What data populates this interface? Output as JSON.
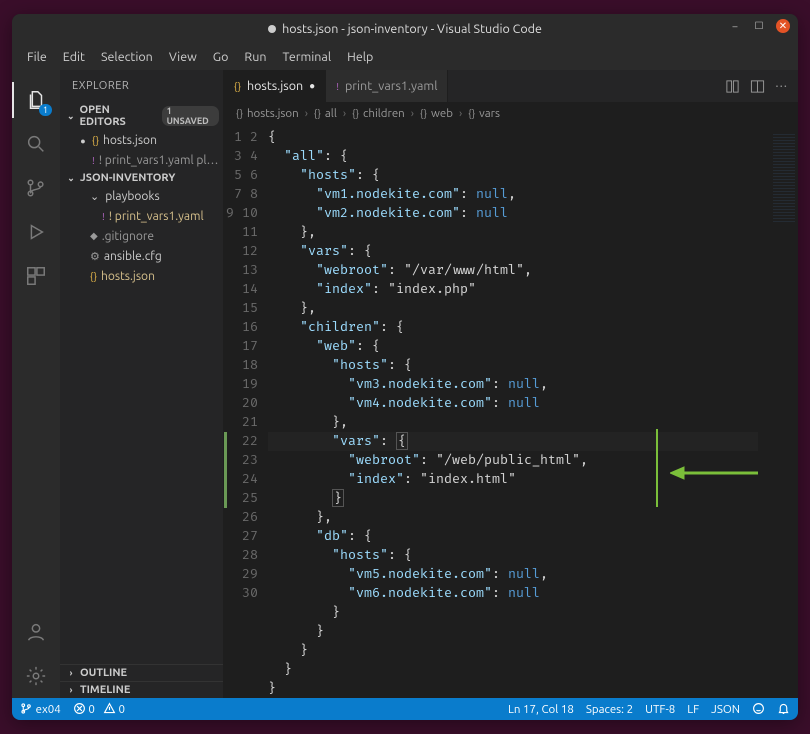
{
  "title": "hosts.json - json-inventory - Visual Studio Code",
  "menu": [
    "File",
    "Edit",
    "Selection",
    "View",
    "Go",
    "Run",
    "Terminal",
    "Help"
  ],
  "activity_badge": "1",
  "sidebar": {
    "title": "EXPLORER",
    "open_editors": {
      "label": "OPEN EDITORS",
      "badge": "1 UNSAVED",
      "items": [
        {
          "label": "hosts.json",
          "modified": true,
          "icon": "json"
        },
        {
          "label": "! print_vars1.yaml  pl…",
          "modified": false,
          "icon": "yaml"
        }
      ]
    },
    "workspace": {
      "label": "JSON-INVENTORY",
      "items": [
        {
          "label": "playbooks",
          "icon": "folder",
          "level": 2,
          "chev": true
        },
        {
          "label": "! print_vars1.yaml",
          "icon": "yaml",
          "level": 3,
          "cls": "yellowish"
        },
        {
          "label": ".gitignore",
          "icon": "file",
          "level": 2,
          "cls": "dimmed"
        },
        {
          "label": "ansible.cfg",
          "icon": "gear",
          "level": 2
        },
        {
          "label": "hosts.json",
          "icon": "json",
          "level": 2,
          "cls": "yellowish"
        }
      ]
    },
    "outline": "OUTLINE",
    "timeline": "TIMELINE"
  },
  "tabs": [
    {
      "label": "hosts.json",
      "icon": "json",
      "active": true,
      "dirty": true
    },
    {
      "label": "print_vars1.yaml",
      "icon": "yaml",
      "active": false,
      "dirty": false
    }
  ],
  "breadcrumbs": [
    "hosts.json",
    "all",
    "children",
    "web",
    "vars"
  ],
  "code_lines": [
    "{",
    "  \"all\": {",
    "    \"hosts\": {",
    "      \"vm1.nodekite.com\": null,",
    "      \"vm2.nodekite.com\": null",
    "    },",
    "    \"vars\": {",
    "      \"webroot\": \"/var/www/html\",",
    "      \"index\": \"index.php\"",
    "    },",
    "    \"children\": {",
    "      \"web\": {",
    "        \"hosts\": {",
    "          \"vm3.nodekite.com\": null,",
    "          \"vm4.nodekite.com\": null",
    "        },",
    "        \"vars\": {",
    "          \"webroot\": \"/web/public_html\",",
    "          \"index\": \"index.html\"",
    "        }",
    "      },",
    "      \"db\": {",
    "        \"hosts\": {",
    "          \"vm5.nodekite.com\": null,",
    "          \"vm6.nodekite.com\": null",
    "        }",
    "      }",
    "    }",
    "  }",
    "}"
  ],
  "status": {
    "branch": "ex04",
    "problems": "0",
    "warnings": "0",
    "linecol": "Ln 17, Col 18",
    "spaces": "Spaces: 2",
    "encoding": "UTF-8",
    "eol": "LF",
    "lang": "JSON"
  }
}
